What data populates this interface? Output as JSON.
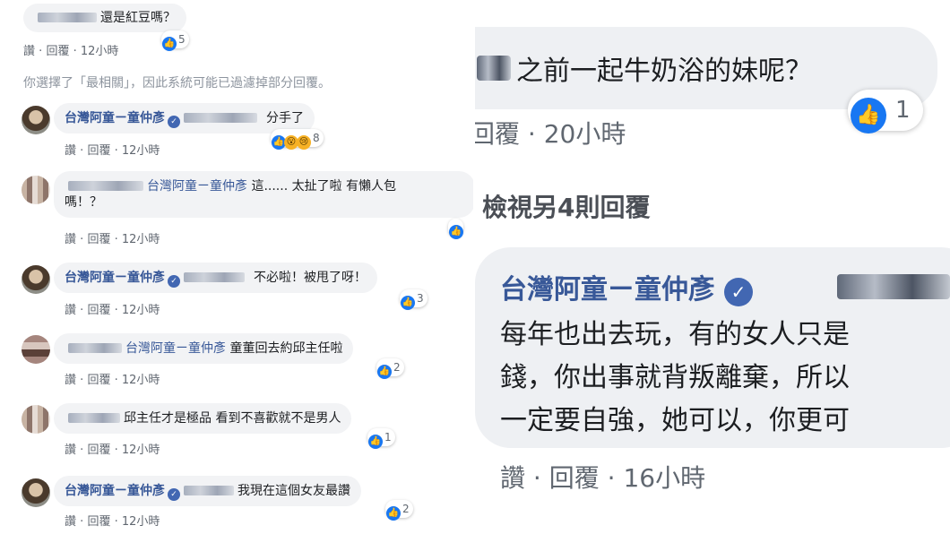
{
  "icons": {
    "like": "thumbs-up-icon",
    "wow": "wow-face-icon",
    "sad": "sad-face-icon",
    "verified": "verified-badge-icon"
  },
  "colors": {
    "link": "#385898",
    "like": "#1877f2",
    "bubble": "#f2f3f5",
    "meta": "#606770"
  },
  "glyphs": {
    "like": "👍",
    "wow": "😮",
    "sad": "😢",
    "verified": "✓",
    "dot": "·"
  },
  "left": {
    "top_comment": {
      "text": "還是紅豆嗎？",
      "actions": {
        "like": "讚",
        "reply": "回覆",
        "time": "12小時"
      },
      "reactions": "5"
    },
    "filter_note": "你選擇了「最相關」，因此系統可能已過濾掉部分回覆。",
    "replies": [
      {
        "name": "台灣阿童ㄧ童仲彥",
        "text": "分手了",
        "actions": {
          "like": "讚",
          "reply": "回覆",
          "time": "12小時"
        },
        "reactions": "8"
      },
      {
        "name": "台灣阿童ㄧ童仲彥",
        "text_line1": "這...... 太扯了啦 有懶人包",
        "text_line2": "嗎！？",
        "actions": {
          "like": "讚",
          "reply": "回覆",
          "time": "12小時"
        },
        "reactions": ""
      },
      {
        "name": "台灣阿童ㄧ童仲彥",
        "text": "不必啦！被甩了呀！",
        "actions": {
          "like": "讚",
          "reply": "回覆",
          "time": "12小時"
        },
        "reactions": "3"
      },
      {
        "name": "台灣阿童ㄧ童仲彥",
        "text": "童董回去約邱主任啦",
        "actions": {
          "like": "讚",
          "reply": "回覆",
          "time": "12小時"
        },
        "reactions": "2"
      },
      {
        "text": "邱主任才是極品 看到不喜歡就不是男人",
        "actions": {
          "like": "讚",
          "reply": "回覆",
          "time": "12小時"
        },
        "reactions": "1"
      },
      {
        "name": "台灣阿童ㄧ童仲彥",
        "text": "我現在這個女友最讚",
        "actions": {
          "like": "讚",
          "reply": "回覆",
          "time": "12小時"
        },
        "reactions": "2"
      }
    ]
  },
  "right": {
    "top_comment": {
      "text": "之前一起牛奶浴的妹呢？",
      "reactions": "1",
      "actions": {
        "reply": "回覆",
        "time": "20小時"
      }
    },
    "view_more": "檢視另4則回覆",
    "reply": {
      "name": "台灣阿童ㄧ童仲彥",
      "line1": "每年也出去玩，有的女人只是",
      "line2": "錢，你出事就背叛離棄，所以",
      "line3": "一定要自強，她可以，你更可",
      "actions": {
        "like": "讚",
        "reply": "回覆",
        "time": "16小時"
      }
    }
  }
}
